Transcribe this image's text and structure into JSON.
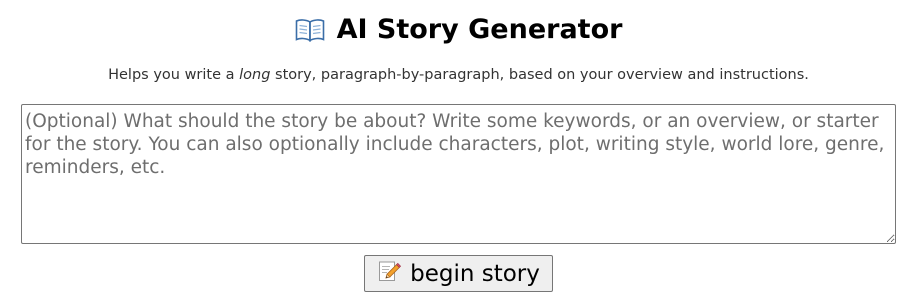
{
  "header": {
    "icon": "open-book-icon",
    "title": "AI Story Generator"
  },
  "description": {
    "before": "Helps you write a ",
    "emphasis": "long",
    "after": " story, paragraph-by-paragraph, based on your overview and instructions."
  },
  "overview_input": {
    "value": "",
    "placeholder": "(Optional) What should the story be about? Write some keywords, or an overview, or starter for the story. You can also optionally include characters, plot, writing style, world lore, genre, reminders, etc."
  },
  "begin_button": {
    "icon": "memo-pencil-icon",
    "label": "begin story"
  },
  "colors": {
    "button_bg": "#efefef",
    "border": "#767676",
    "placeholder": "#6e6e6e"
  }
}
